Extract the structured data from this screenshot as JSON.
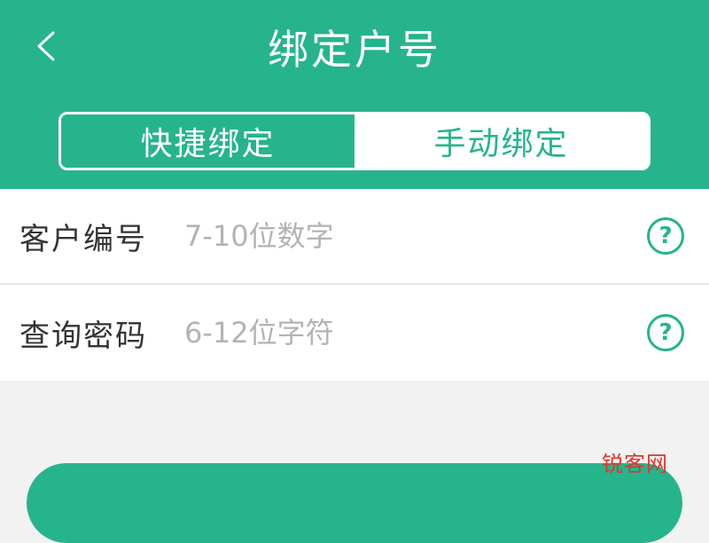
{
  "header": {
    "title": "绑定户号",
    "back_icon": "chevron-left-icon"
  },
  "tabs": [
    {
      "label": "快捷绑定",
      "active": true
    },
    {
      "label": "手动绑定",
      "active": false
    }
  ],
  "form": {
    "customer_number": {
      "label": "客户编号",
      "placeholder": "7-10位数字",
      "value": ""
    },
    "query_password": {
      "label": "查询密码",
      "placeholder": "6-12位字符",
      "value": ""
    },
    "help_icon_glyph": "?"
  },
  "watermark": "锐客网",
  "colors": {
    "accent": "#26b48c",
    "background": "#f2f2f2",
    "placeholder": "#b3b3b3",
    "watermark": "#e0352b"
  }
}
